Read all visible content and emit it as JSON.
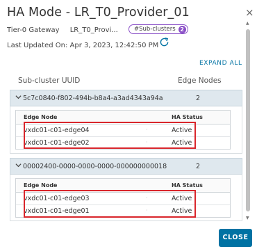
{
  "dialog": {
    "title": "HA Mode - LR_T0_Provider_01",
    "close_glyph": "×"
  },
  "meta": {
    "gateway_label": "Tier-0 Gateway",
    "gateway_value": "LR_T0_Provi...",
    "subclusters_label": "#Sub-clusters",
    "subclusters_count": "2",
    "updated_text": "Last Updated On: Apr 3, 2023, 12:42:50 PM"
  },
  "expand_all_label": "EXPAND ALL",
  "table": {
    "col_uuid": "Sub-cluster UUID",
    "col_edge_nodes": "Edge Nodes"
  },
  "groups": [
    {
      "uuid": "5c7c0840-f802-494b-b8a4-a3ad4343a94a",
      "count": "2",
      "inner_headers": {
        "edge_node": "Edge Node",
        "ha_status": "HA Status"
      },
      "rows": [
        {
          "node": "vxdc01-c01-edge04",
          "dot": "·",
          "status": "Active"
        },
        {
          "node": "vxdc01-c01-edge02",
          "dot": "·",
          "status": "Active"
        }
      ]
    },
    {
      "uuid": "00002400-0000-0000-0000-000000000018",
      "count": "2",
      "inner_headers": {
        "edge_node": "Edge Node",
        "ha_status": "HA Status"
      },
      "rows": [
        {
          "node": "vxdc01-c01-edge03",
          "dot": "·",
          "status": "Active"
        },
        {
          "node": "vxdc01-c01-edge01",
          "dot": "·",
          "status": "Active"
        }
      ]
    }
  ],
  "buttons": {
    "close": "CLOSE"
  },
  "colors": {
    "accent": "#0072a3",
    "pill": "#8a4fc7",
    "highlight": "#d9262c",
    "group_header": "#dfe8ee"
  },
  "icons": [
    "close-icon",
    "refresh-icon",
    "chevron-down-icon",
    "scroll-up-icon",
    "scroll-down-icon"
  ]
}
